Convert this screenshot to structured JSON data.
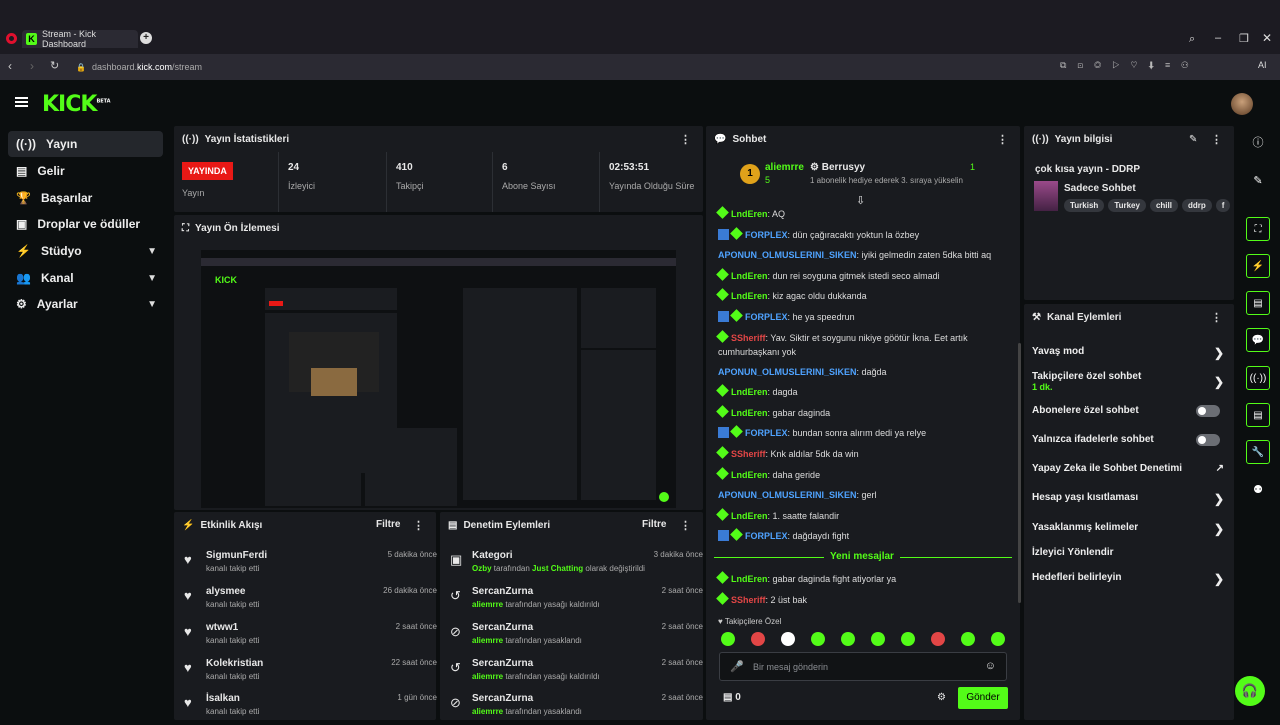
{
  "browser": {
    "tab_title": "Stream - Kick Dashboard",
    "url_prefix": "dashboard.",
    "url_domain": "kick.com",
    "url_path": "/stream",
    "ai_label": "AI"
  },
  "brand": {
    "logo": "KICK",
    "beta": "BETA",
    "accent": "#53fc18"
  },
  "sidebar": {
    "items": [
      {
        "label": "Yayın",
        "icon": "broadcast-icon",
        "active": true
      },
      {
        "label": "Gelir",
        "icon": "wallet-icon"
      },
      {
        "label": "Başarılar",
        "icon": "trophy-icon"
      },
      {
        "label": "Droplar ve ödüller",
        "icon": "gift-icon"
      },
      {
        "label": "Stüdyo",
        "icon": "bolt-icon",
        "expand": true
      },
      {
        "label": "Kanal",
        "icon": "people-icon",
        "expand": true
      },
      {
        "label": "Ayarlar",
        "icon": "gear-icon",
        "expand": true
      }
    ]
  },
  "stats": {
    "title": "Yayın İstatistikleri",
    "live_badge": "YAYINDA",
    "live_label": "Yayın",
    "viewers_value": "24",
    "viewers_label": "İzleyici",
    "followers_value": "410",
    "followers_label": "Takipçi",
    "subs_value": "6",
    "subs_label": "Abone Sayısı",
    "uptime_value": "02:53:51",
    "uptime_label": "Yayında Olduğu Süre"
  },
  "preview": {
    "title": "Yayın Ön İzlemesi"
  },
  "activity": {
    "title": "Etkinlik Akışı",
    "filter": "Filtre",
    "items": [
      {
        "name": "SigmunFerdi",
        "sub": "kanalı takip etti",
        "time": "5 dakika önce"
      },
      {
        "name": "alysmee",
        "sub": "kanalı takip etti",
        "time": "26 dakika önce"
      },
      {
        "name": "wtww1",
        "sub": "kanalı takip etti",
        "time": "2 saat önce"
      },
      {
        "name": "Kolekristian",
        "sub": "kanalı takip etti",
        "time": "22 saat önce"
      },
      {
        "name": "İsalkan",
        "sub": "kanalı takip etti",
        "time": "1 gün önce"
      }
    ]
  },
  "moderation": {
    "title": "Denetim Eylemleri",
    "filter": "Filtre",
    "items": [
      {
        "name": "Kategori",
        "time": "3 dakika önce",
        "p1": "Ozby",
        "p2": " tarafından ",
        "p3": "Just Chatting",
        "p4": " olarak değiştirildi",
        "icon": "category-icon"
      },
      {
        "name": "SercanZurna",
        "time": "2 saat önce",
        "p1": "aliemrre",
        "p2": " tarafından yasağı kaldırıldı",
        "icon": "undo-icon"
      },
      {
        "name": "SercanZurna",
        "time": "2 saat önce",
        "p1": "aliemrre",
        "p2": " tarafından yasaklandı",
        "icon": "ban-icon"
      },
      {
        "name": "SercanZurna",
        "time": "2 saat önce",
        "p1": "aliemrre",
        "p2": " tarafından yasağı kaldırıldı",
        "icon": "undo-icon"
      },
      {
        "name": "SercanZurna",
        "time": "2 saat önce",
        "p1": "aliemrre",
        "p2": " tarafından yasaklandı",
        "icon": "ban-icon"
      }
    ]
  },
  "chat": {
    "title": "Sohbet",
    "pinned": {
      "rank": "1",
      "user": "aliemrre",
      "count": "5",
      "gifter": "Berrusyy",
      "gift_count": "1",
      "gift_text": "1 abonelik hediye ederek 3. sıraya yükselin"
    },
    "messages": [
      {
        "user": "LndEren",
        "color": "green",
        "badges": [
          "g"
        ],
        "text": "AQ"
      },
      {
        "user": "FORPLEX",
        "color": "blue",
        "badges": [
          "b",
          "g"
        ],
        "text": "dün çağıracaktı yoktun la özbey"
      },
      {
        "user": "APONUN_OLMUSLERINI_SIKEN",
        "color": "blue",
        "badges": [],
        "text": "iyiki gelmedin zaten 5dka bitti aq"
      },
      {
        "user": "LndEren",
        "color": "green",
        "badges": [
          "g"
        ],
        "text": "dun rei soyguna gitmek istedi seco almadi"
      },
      {
        "user": "LndEren",
        "color": "green",
        "badges": [
          "g"
        ],
        "text": "kiz agac oldu dukkanda"
      },
      {
        "user": "FORPLEX",
        "color": "blue",
        "badges": [
          "b",
          "g"
        ],
        "text": "he ya speedrun"
      },
      {
        "user": "SSheriff",
        "color": "red",
        "badges": [
          "g"
        ],
        "text": "Yav. Siktir et soygunu nikiye göötür İkna. Eet artık cumhurbaşkanı yok"
      },
      {
        "user": "APONUN_OLMUSLERINI_SIKEN",
        "color": "blue",
        "badges": [],
        "text": "dağda"
      },
      {
        "user": "LndEren",
        "color": "green",
        "badges": [
          "g"
        ],
        "text": "dagda"
      },
      {
        "user": "LndEren",
        "color": "green",
        "badges": [
          "g"
        ],
        "text": "gabar daginda"
      },
      {
        "user": "FORPLEX",
        "color": "blue",
        "badges": [
          "b",
          "g"
        ],
        "text": "bundan sonra alırım dedi ya relye"
      },
      {
        "user": "SSheriff",
        "color": "red",
        "badges": [
          "g"
        ],
        "text": "Knk aldılar 5dk da win"
      },
      {
        "user": "LndEren",
        "color": "green",
        "badges": [
          "g"
        ],
        "text": "daha geride"
      },
      {
        "user": "APONUN_OLMUSLERINI_SIKEN",
        "color": "blue",
        "badges": [],
        "text": "gerl"
      },
      {
        "user": "LndEren",
        "color": "green",
        "badges": [
          "g"
        ],
        "text": "1. saatte falandir"
      },
      {
        "user": "FORPLEX",
        "color": "blue",
        "badges": [
          "b",
          "g"
        ],
        "text": "dağdaydı fight"
      }
    ],
    "new_messages": "Yeni mesajlar",
    "messages_after": [
      {
        "user": "LndEren",
        "color": "green",
        "badges": [
          "g"
        ],
        "text": "gabar daginda fight atiyorlar ya"
      },
      {
        "user": "SSheriff",
        "color": "red",
        "badges": [
          "g"
        ],
        "text": "2 üst bak"
      }
    ],
    "emote_label": "Takipçilere Özel",
    "input_placeholder": "Bir mesaj gönderin",
    "points": "0",
    "send": "Gönder"
  },
  "stream_info": {
    "title": "Yayın bilgisi",
    "stream_title": "çok kısa yayın - DDRP",
    "category": "Sadece Sohbet",
    "tags": [
      "Turkish",
      "Turkey",
      "chill",
      "ddrp",
      "f"
    ]
  },
  "channel_actions": {
    "title": "Kanal Eylemleri",
    "items": [
      {
        "label": "Yavaş mod",
        "kind": "arrow"
      },
      {
        "label": "Takipçilere özel sohbet",
        "sub": "1 dk.",
        "kind": "arrow"
      },
      {
        "label": "Abonelere özel sohbet",
        "kind": "toggle"
      },
      {
        "label": "Yalnızca ifadelerle sohbet",
        "kind": "toggle"
      },
      {
        "label": "Yapay Zeka ile Sohbet Denetimi",
        "kind": "external"
      },
      {
        "label": "Hesap yaşı kısıtlaması",
        "kind": "arrow"
      },
      {
        "label": "Yasaklanmış kelimeler",
        "kind": "arrow"
      },
      {
        "label": "İzleyici Yönlendir",
        "kind": "none"
      },
      {
        "label": "Hedefleri belirleyin",
        "kind": "arrow"
      }
    ]
  }
}
